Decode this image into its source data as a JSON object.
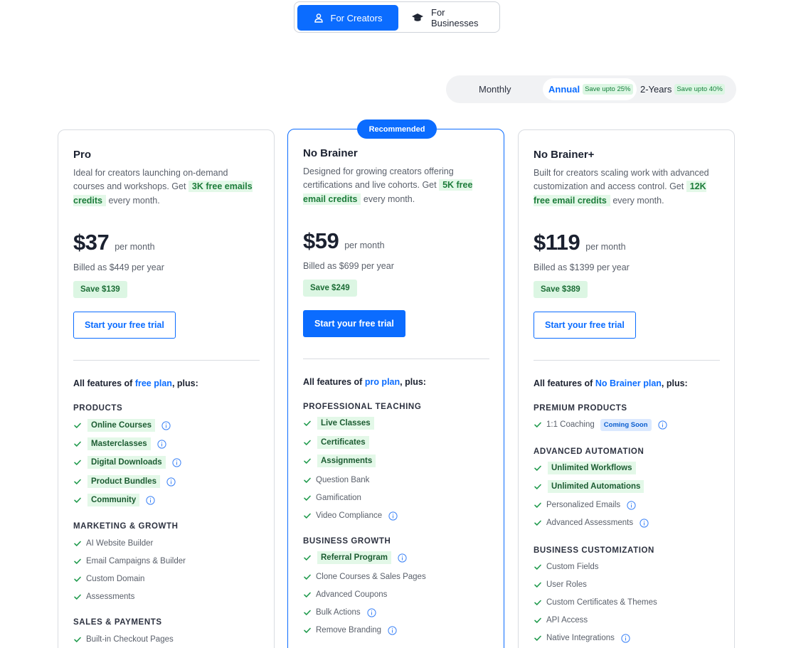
{
  "audience_toggle": {
    "creators_label": "For Creators",
    "business_label": "For Businesses"
  },
  "billing_toggle": {
    "monthly_label": "Monthly",
    "annual_label": "Annual",
    "annual_save": "Save upto 25%",
    "two_years_label": "2-Years",
    "two_years_save": "Save upto 40%",
    "selected": "Annual"
  },
  "colors": {
    "accent": "#0b6cff",
    "highlight_bg": "#e3f8e8",
    "highlight_text": "#1c7c3a"
  },
  "plans": [
    {
      "name": "Pro",
      "desc_before": "Ideal for creators launching on-demand courses and workshops. Get ",
      "desc_highlight": "3K free emails credits",
      "desc_after": " every month.",
      "price": "$37",
      "per": "per month",
      "billed": "Billed as $449 per year",
      "save": "Save $139",
      "cta": "Start your free trial",
      "all_prefix": "All features of ",
      "all_link": "free plan",
      "all_suffix": ", plus:",
      "sections": [
        {
          "title": "PRODUCTS",
          "items": [
            {
              "name": "Online Courses",
              "highlight": true,
              "info": true
            },
            {
              "name": "Masterclasses",
              "highlight": true,
              "info": true
            },
            {
              "name": "Digital Downloads",
              "highlight": true,
              "info": true
            },
            {
              "name": "Product Bundles",
              "highlight": true,
              "info": true
            },
            {
              "name": "Community",
              "highlight": true,
              "info": true
            }
          ]
        },
        {
          "title": "MARKETING & GROWTH",
          "items": [
            {
              "name": "AI Website Builder"
            },
            {
              "name": "Email Campaigns & Builder"
            },
            {
              "name": "Custom Domain"
            },
            {
              "name": "Assessments"
            }
          ]
        },
        {
          "title": "SALES & PAYMENTS",
          "items": [
            {
              "name": "Built-in Checkout Pages"
            }
          ]
        }
      ]
    },
    {
      "name": "No Brainer",
      "badge": "Recommended",
      "desc_before": "Designed for growing creators offering certifications and live cohorts. Get ",
      "desc_highlight": "5K free email credits",
      "desc_after": " every month.",
      "price": "$59",
      "per": "per month",
      "billed": "Billed as $699 per year",
      "save": "Save $249",
      "cta": "Start your free trial",
      "all_prefix": "All features of ",
      "all_link": "pro plan",
      "all_suffix": ", plus:",
      "sections": [
        {
          "title": "PROFESSIONAL TEACHING",
          "items": [
            {
              "name": "Live Classes",
              "highlight": true
            },
            {
              "name": "Certificates",
              "highlight": true
            },
            {
              "name": "Assignments",
              "highlight": true
            },
            {
              "name": "Question Bank"
            },
            {
              "name": "Gamification"
            },
            {
              "name": "Video Compliance",
              "info": true
            }
          ]
        },
        {
          "title": "BUSINESS GROWTH",
          "items": [
            {
              "name": "Referral Program",
              "highlight": true,
              "info": true
            },
            {
              "name": "Clone Courses & Sales Pages"
            },
            {
              "name": "Advanced Coupons"
            },
            {
              "name": "Bulk Actions",
              "info": true
            },
            {
              "name": "Remove Branding",
              "info": true
            }
          ]
        }
      ]
    },
    {
      "name": "No Brainer+",
      "desc_before": "Built for creators scaling work with advanced customization and access control. Get ",
      "desc_highlight": "12K free email credits",
      "desc_after": " every month.",
      "price": "$119",
      "per": "per month",
      "billed": "Billed as $1399 per year",
      "save": "Save $389",
      "cta": "Start your free trial",
      "all_prefix": "All features of ",
      "all_link": "No Brainer plan",
      "all_suffix": ", plus:",
      "sections": [
        {
          "title": "PREMIUM PRODUCTS",
          "items": [
            {
              "name": "1:1 Coaching",
              "soon": "Coming Soon",
              "info": true
            }
          ]
        },
        {
          "title": "ADVANCED AUTOMATION",
          "items": [
            {
              "name": "Unlimited Workflows",
              "highlight": true
            },
            {
              "name": "Unlimited Automations",
              "highlight": true
            },
            {
              "name": "Personalized Emails",
              "info": true
            },
            {
              "name": "Advanced Assessments",
              "info": true
            }
          ]
        },
        {
          "title": "BUSINESS CUSTOMIZATION",
          "items": [
            {
              "name": "Custom Fields"
            },
            {
              "name": "User Roles"
            },
            {
              "name": "Custom Certificates & Themes"
            },
            {
              "name": "API Access"
            },
            {
              "name": "Native Integrations",
              "info": true
            }
          ]
        }
      ]
    }
  ]
}
